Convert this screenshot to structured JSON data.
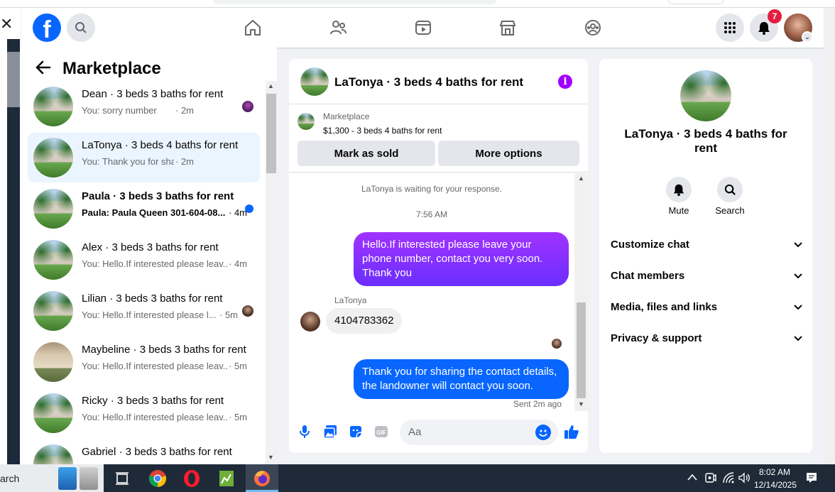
{
  "header": {
    "notification_count": "7",
    "icons": [
      "facebook-logo",
      "search-icon",
      "home-icon",
      "friends-icon",
      "video-icon",
      "marketplace-icon",
      "groups-icon",
      "menu-grid-icon",
      "bell-icon",
      "profile-avatar"
    ]
  },
  "sidebar": {
    "title": "Marketplace",
    "conversations": [
      {
        "name": "Dean · 3 beds 3 baths for rent",
        "preview": "You: sorry number",
        "time": "· 2m",
        "unread": false
      },
      {
        "name": "LaTonya · 3 beds 4 baths for rent",
        "preview": "You: Thank you for sharing the co...",
        "time": "· 2m",
        "unread": false,
        "active": true
      },
      {
        "name": "Paula · 3 beds 3 baths for rent",
        "preview": "Paula: Paula Queen 301-604-08...",
        "time": "· 4m",
        "unread": true
      },
      {
        "name": "Alex · 3 beds 3 baths for rent",
        "preview": "You: Hello.If interested please leav...",
        "time": "· 4m",
        "unread": false
      },
      {
        "name": "Lilian · 3 beds 3 baths for rent",
        "preview": "You: Hello.If interested please l...",
        "time": "· 5m",
        "unread": false
      },
      {
        "name": "Maybeline · 3 beds 3 baths for rent",
        "preview": "You: Hello.If interested please leav...",
        "time": "· 5m",
        "unread": false
      },
      {
        "name": "Ricky · 3 beds 3 baths for rent",
        "preview": "You: Hello.If interested please leav...",
        "time": "· 5m",
        "unread": false
      },
      {
        "name": "Gabriel · 3 beds 3 baths for rent",
        "preview": "",
        "time": "",
        "unread": false
      }
    ]
  },
  "chat": {
    "title": "LaTonya · 3 beds 4 baths for rent",
    "listing_source": "Marketplace",
    "listing_price": "$1,300 - 3 beds 4 baths for rent",
    "mark_sold_label": "Mark as sold",
    "more_options_label": "More options",
    "waiting_text": "LaTonya is waiting for your response.",
    "timestamp": "7:56 AM",
    "messages": [
      {
        "from": "me",
        "text": "Hello.If interested please leave your phone number, contact you very soon. Thank you"
      },
      {
        "from": "LaTonya",
        "sender_label": "LaTonya",
        "text": "4104783362"
      },
      {
        "from": "me",
        "text": "Thank you for sharing the contact details, the landowner will contact you soon."
      }
    ],
    "sent_status": "Sent 2m ago",
    "composer_placeholder": "Aa"
  },
  "info_panel": {
    "name": "LaTonya · 3 beds 4 baths for rent",
    "actions": [
      {
        "label": "Mute"
      },
      {
        "label": "Search"
      }
    ],
    "sections": [
      "Customize chat",
      "Chat members",
      "Media, files and links",
      "Privacy & support"
    ]
  },
  "taskbar": {
    "search_text": "arch",
    "time": "8:02 AM",
    "date": "12/14/2025"
  },
  "colors": {
    "fb_blue": "#0866ff",
    "gradient_purple": "#a033ff",
    "active_row": "#ebf5ff",
    "badge_red": "#e41e3f"
  }
}
